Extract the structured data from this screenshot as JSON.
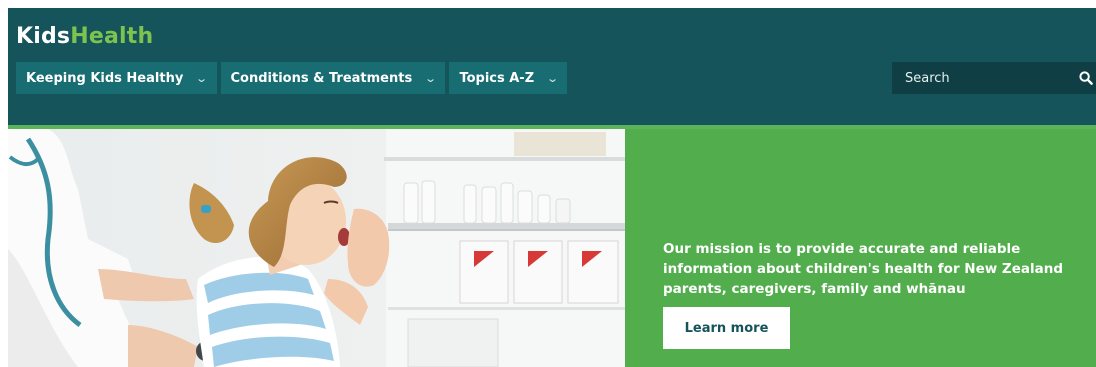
{
  "logo": {
    "kids": "Kids",
    "health": "Health"
  },
  "nav": {
    "items": [
      {
        "label": "Keeping Kids Healthy",
        "icon": "chevron-down-icon"
      },
      {
        "label": "Conditions & Treatments",
        "icon": "chevron-down-icon"
      },
      {
        "label": "Topics A-Z",
        "icon": "chevron-down-icon"
      }
    ]
  },
  "search": {
    "placeholder": "Search",
    "icon": "search-icon"
  },
  "hero": {
    "image": "child-coughing-doctor-stethoscope",
    "mission_text": "Our mission is to provide accurate and reliable information about children's health for New Zealand parents, caregivers, family and whānau",
    "button_label": "Learn more"
  },
  "colors": {
    "header_bg": "#14545a",
    "nav_item_bg": "#176d72",
    "search_bg": "#0f3f44",
    "logo_accent": "#7cc44f",
    "mission_bg": "#52ad4d"
  }
}
